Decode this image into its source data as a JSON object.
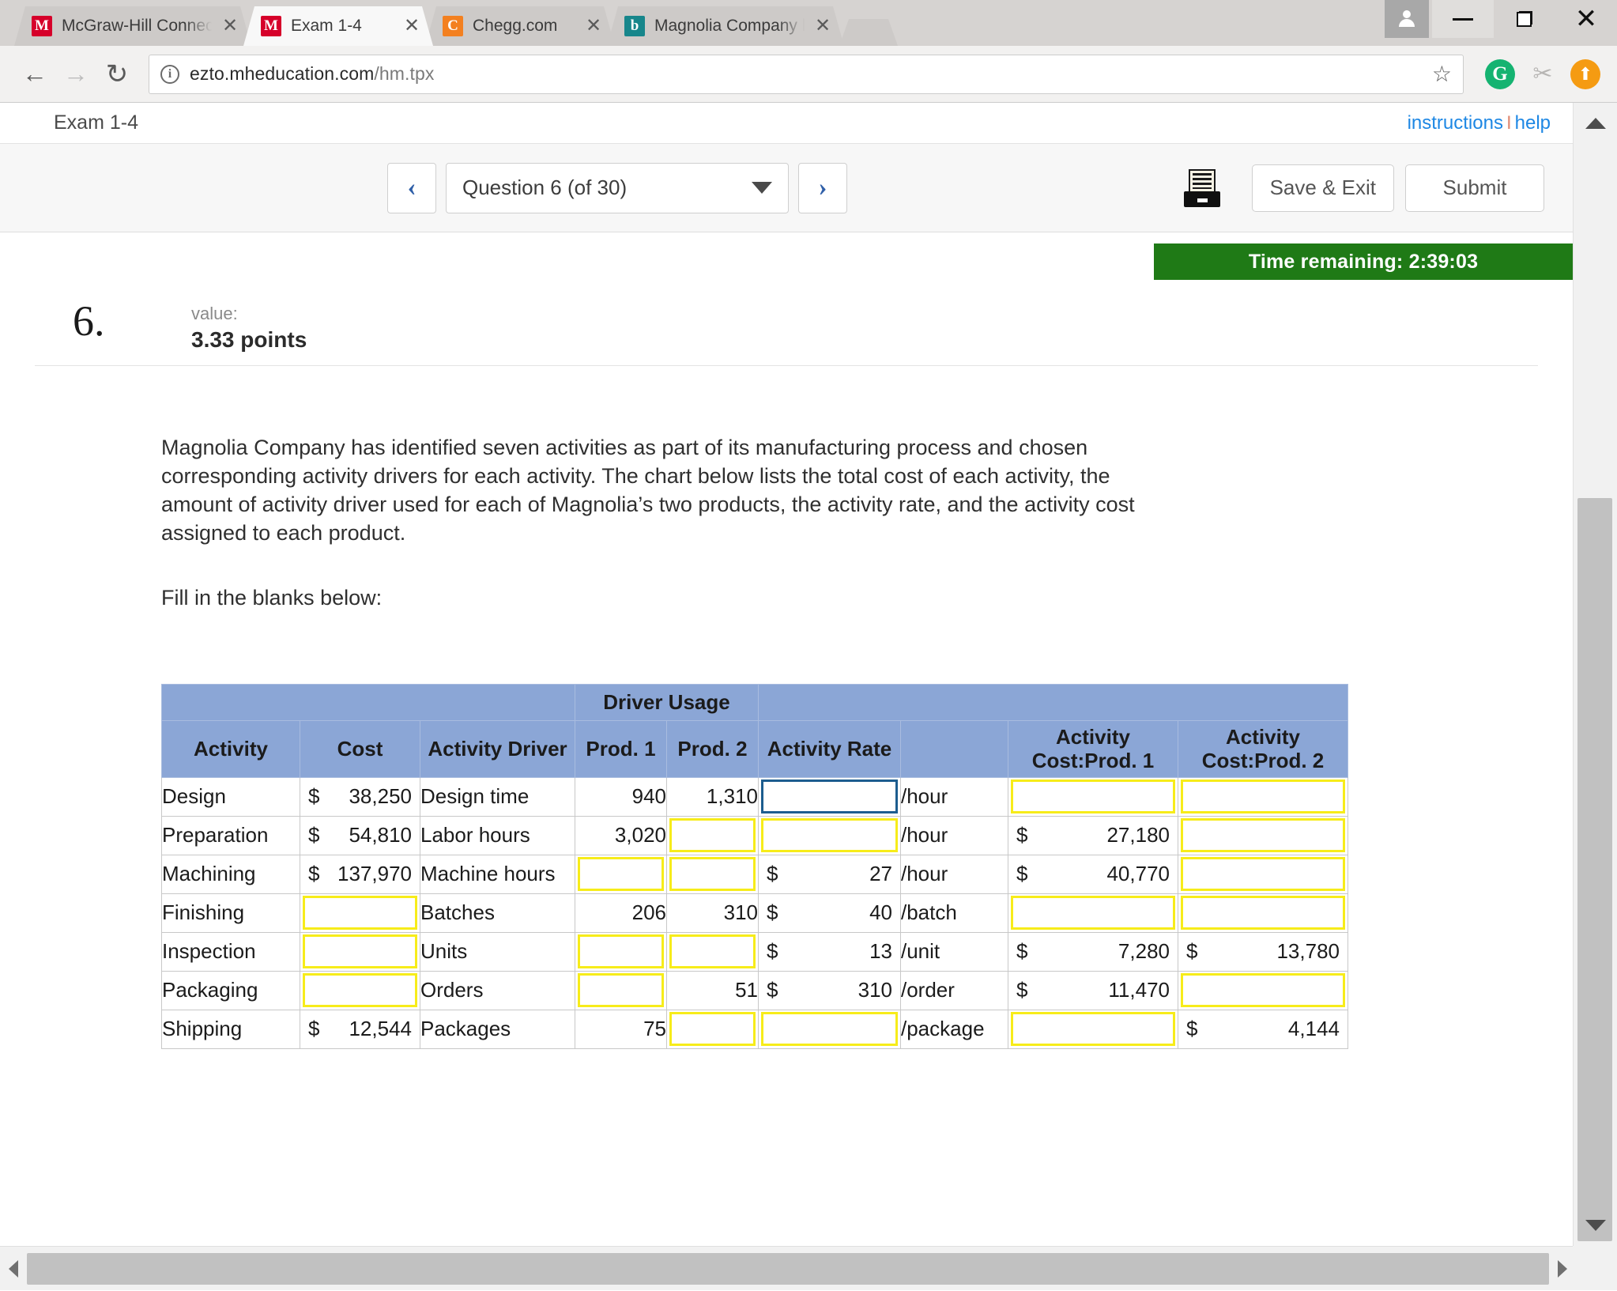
{
  "browser": {
    "tabs": [
      {
        "title": "McGraw-Hill Connect |",
        "favicon": "mcgraw-hill-icon",
        "active": false,
        "close_label": "✕"
      },
      {
        "title": "Exam 1-4",
        "favicon": "mcgraw-hill-icon",
        "active": true,
        "close_label": "✕"
      },
      {
        "title": "Chegg.com",
        "favicon": "chegg-icon",
        "active": false,
        "close_label": "✕"
      },
      {
        "title": "Magnolia Company ha",
        "favicon": "bing-icon",
        "active": false,
        "close_label": "✕"
      }
    ],
    "favicon_glyphs": {
      "mcgraw-hill-icon": "M",
      "chegg-icon": "C",
      "bing-icon": "b"
    },
    "window_controls": {
      "minimize": "—",
      "restore": "restore",
      "close": "✕",
      "profile": "profile-icon"
    },
    "nav": {
      "back": "←",
      "forward": "→",
      "reload": "↻"
    },
    "address": {
      "host": "ezto.mheducation.com",
      "path": "/hm.tpx",
      "security_label": "i"
    },
    "toolbar_icons": [
      "bookmark-star-icon",
      "grammarly-icon",
      "honey-icon",
      "updater-icon"
    ],
    "star": "☆",
    "grammarly_glyph": "G",
    "honey_glyph": "✂",
    "updater_glyph": "⬆"
  },
  "exam": {
    "name": "Exam 1-4",
    "links": {
      "instructions": "instructions",
      "separator": "I",
      "help": "help"
    },
    "nav": {
      "prev": "‹",
      "next": "›",
      "question_selector": "Question 6 (of 30)"
    },
    "actions": {
      "print": "printer-icon",
      "save_exit": "Save & Exit",
      "submit": "Submit"
    },
    "timer": "Time remaining: 2:39:03",
    "timer_color": "#1f7a16"
  },
  "question": {
    "number": "6.",
    "value_label": "value:",
    "points": "3.33 points",
    "paragraph1": "Magnolia Company has identified seven activities as part of its manufacturing process and chosen corresponding activity drivers for each activity. The chart below lists the total cost of each activity, the amount of activity driver used for each of Magnolia’s two products, the activity rate, and the activity cost assigned to each product.",
    "paragraph2": "Fill in the blanks below:"
  },
  "table": {
    "group_header": "Driver Usage",
    "headers": [
      "Activity",
      "Cost",
      "Activity Driver",
      "Prod. 1",
      "Prod. 2",
      "Activity Rate",
      "",
      "Activity Cost:Prod. 1",
      "Activity Cost:Prod. 2"
    ],
    "rows": [
      {
        "activity": "Design",
        "cost": {
          "sym": "$",
          "amt": "38,250",
          "blank": false
        },
        "driver": "Design time",
        "prod1": {
          "value": "940",
          "blank": false
        },
        "prod2": {
          "value": "1,310",
          "blank": false
        },
        "rate": {
          "sym": "",
          "amt": "",
          "blank": true,
          "focused": true
        },
        "unit": "/hour",
        "cost_p1": {
          "sym": "",
          "amt": "",
          "blank": true
        },
        "cost_p2": {
          "sym": "",
          "amt": "",
          "blank": true
        }
      },
      {
        "activity": "Preparation",
        "cost": {
          "sym": "$",
          "amt": "54,810",
          "blank": false
        },
        "driver": "Labor hours",
        "prod1": {
          "value": "3,020",
          "blank": false
        },
        "prod2": {
          "value": "",
          "blank": true
        },
        "rate": {
          "sym": "",
          "amt": "",
          "blank": true,
          "focused": false
        },
        "unit": "/hour",
        "cost_p1": {
          "sym": "$",
          "amt": "27,180",
          "blank": false
        },
        "cost_p2": {
          "sym": "",
          "amt": "",
          "blank": true
        }
      },
      {
        "activity": "Machining",
        "cost": {
          "sym": "$",
          "amt": "137,970",
          "blank": false
        },
        "driver": "Machine hours",
        "prod1": {
          "value": "",
          "blank": true
        },
        "prod2": {
          "value": "",
          "blank": true
        },
        "rate": {
          "sym": "$",
          "amt": "27",
          "blank": false,
          "focused": false
        },
        "unit": "/hour",
        "cost_p1": {
          "sym": "$",
          "amt": "40,770",
          "blank": false
        },
        "cost_p2": {
          "sym": "",
          "amt": "",
          "blank": true
        }
      },
      {
        "activity": "Finishing",
        "cost": {
          "sym": "",
          "amt": "",
          "blank": true
        },
        "driver": "Batches",
        "prod1": {
          "value": "206",
          "blank": false
        },
        "prod2": {
          "value": "310",
          "blank": false
        },
        "rate": {
          "sym": "$",
          "amt": "40",
          "blank": false,
          "focused": false
        },
        "unit": "/batch",
        "cost_p1": {
          "sym": "",
          "amt": "",
          "blank": true
        },
        "cost_p2": {
          "sym": "",
          "amt": "",
          "blank": true
        }
      },
      {
        "activity": "Inspection",
        "cost": {
          "sym": "",
          "amt": "",
          "blank": true
        },
        "driver": "Units",
        "prod1": {
          "value": "",
          "blank": true
        },
        "prod2": {
          "value": "",
          "blank": true
        },
        "rate": {
          "sym": "$",
          "amt": "13",
          "blank": false,
          "focused": false
        },
        "unit": "/unit",
        "cost_p1": {
          "sym": "$",
          "amt": "7,280",
          "blank": false
        },
        "cost_p2": {
          "sym": "$",
          "amt": "13,780",
          "blank": false
        }
      },
      {
        "activity": "Packaging",
        "cost": {
          "sym": "",
          "amt": "",
          "blank": true
        },
        "driver": "Orders",
        "prod1": {
          "value": "",
          "blank": true
        },
        "prod2": {
          "value": "51",
          "blank": false
        },
        "rate": {
          "sym": "$",
          "amt": "310",
          "blank": false,
          "focused": false
        },
        "unit": "/order",
        "cost_p1": {
          "sym": "$",
          "amt": "11,470",
          "blank": false
        },
        "cost_p2": {
          "sym": "",
          "amt": "",
          "blank": true
        }
      },
      {
        "activity": "Shipping",
        "cost": {
          "sym": "$",
          "amt": "12,544",
          "blank": false
        },
        "driver": "Packages",
        "prod1": {
          "value": "75",
          "blank": false
        },
        "prod2": {
          "value": "",
          "blank": true
        },
        "rate": {
          "sym": "",
          "amt": "",
          "blank": true,
          "focused": false
        },
        "unit": "/package",
        "cost_p1": {
          "sym": "",
          "amt": "",
          "blank": true
        },
        "cost_p2": {
          "sym": "$",
          "amt": "4,144",
          "blank": false
        }
      }
    ]
  },
  "scroll": {
    "vertical": {
      "up": "▲",
      "down": "▼"
    },
    "horizontal": {
      "left": "◀",
      "right": "▶"
    }
  }
}
